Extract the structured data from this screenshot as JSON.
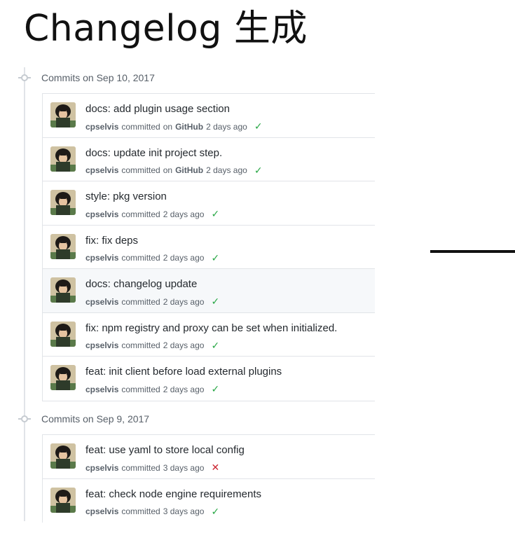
{
  "slide": {
    "title": "Changelog 生成"
  },
  "groups": [
    {
      "header": "Commits on Sep 10, 2017",
      "commits": [
        {
          "title": "docs: add plugin usage section",
          "author": "cpselvis",
          "committed": "committed",
          "on": "on",
          "committer": "GitHub",
          "time": "2 days ago",
          "status": "✓"
        },
        {
          "title": "docs: update init project step.",
          "author": "cpselvis",
          "committed": "committed",
          "on": "on",
          "committer": "GitHub",
          "time": "2 days ago",
          "status": "✓"
        },
        {
          "title": "style: pkg version",
          "author": "cpselvis",
          "committed": "committed",
          "time": "2 days ago",
          "status": "✓"
        },
        {
          "title": "fix: fix deps",
          "author": "cpselvis",
          "committed": "committed",
          "time": "2 days ago",
          "status": "✓"
        },
        {
          "title": "docs: changelog update",
          "author": "cpselvis",
          "committed": "committed",
          "time": "2 days ago",
          "status": "✓"
        },
        {
          "title": "fix: npm registry and proxy can be set when initialized.",
          "author": "cpselvis",
          "committed": "committed",
          "time": "2 days ago",
          "status": "✓"
        },
        {
          "title": "feat: init client before load external plugins",
          "author": "cpselvis",
          "committed": "committed",
          "time": "2 days ago",
          "status": "✓"
        }
      ]
    },
    {
      "header": "Commits on Sep 9, 2017",
      "commits": [
        {
          "title": "feat: use yaml to store local config",
          "author": "cpselvis",
          "committed": "committed",
          "time": "3 days ago",
          "status": "✕"
        },
        {
          "title": "feat: check node engine requirements",
          "author": "cpselvis",
          "committed": "committed",
          "time": "3 days ago",
          "status": "✓"
        }
      ]
    }
  ],
  "colors": {
    "success": "#28a745",
    "failure": "#cb2431",
    "border": "#e1e4e8",
    "muted": "#586069"
  }
}
